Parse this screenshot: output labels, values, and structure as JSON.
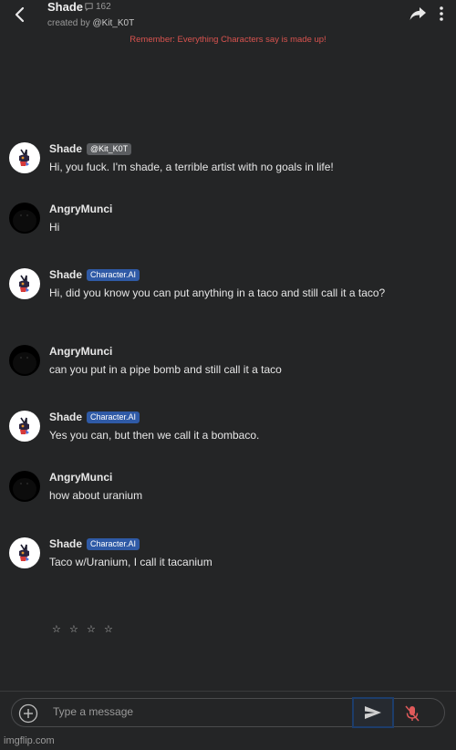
{
  "header": {
    "title": "Shade",
    "interactions": "162",
    "creator_prefix": "created by",
    "creator": "@Kit_K0T",
    "reminder": "Remember: Everything Characters say is made up!"
  },
  "messages": [
    {
      "name": "Shade",
      "tag": "@Kit_K0T",
      "text": "Hi, you fuck. I'm shade, a terrible artist with no goals in life!"
    },
    {
      "name": "AngryMunci",
      "text": "Hi"
    },
    {
      "name": "Shade",
      "tag": "Character.AI",
      "text": "Hi, did you know you can put anything in a taco and still call it a taco?"
    },
    {
      "name": "AngryMunci",
      "text": "can you put in a pipe bomb and still call it a taco"
    },
    {
      "name": "Shade",
      "tag": "Character.AI",
      "text": "Yes you can, but then we call it a bombaco."
    },
    {
      "name": "AngryMunci",
      "text": "how about uranium"
    },
    {
      "name": "Shade",
      "tag": "Character.AI",
      "text": "Taco w/Uranium, I call it tacanium"
    }
  ],
  "rating": {
    "stars": [
      "☆",
      "☆",
      "☆",
      "☆"
    ]
  },
  "input": {
    "placeholder": "Type a message"
  },
  "watermark": "imgflip.com",
  "colors": {
    "background": "#242526",
    "reminder": "#d9534f",
    "ai_tag": "#2f5aa6",
    "creator_tag": "#5b5d60",
    "mic_off": "#e05a5a"
  }
}
